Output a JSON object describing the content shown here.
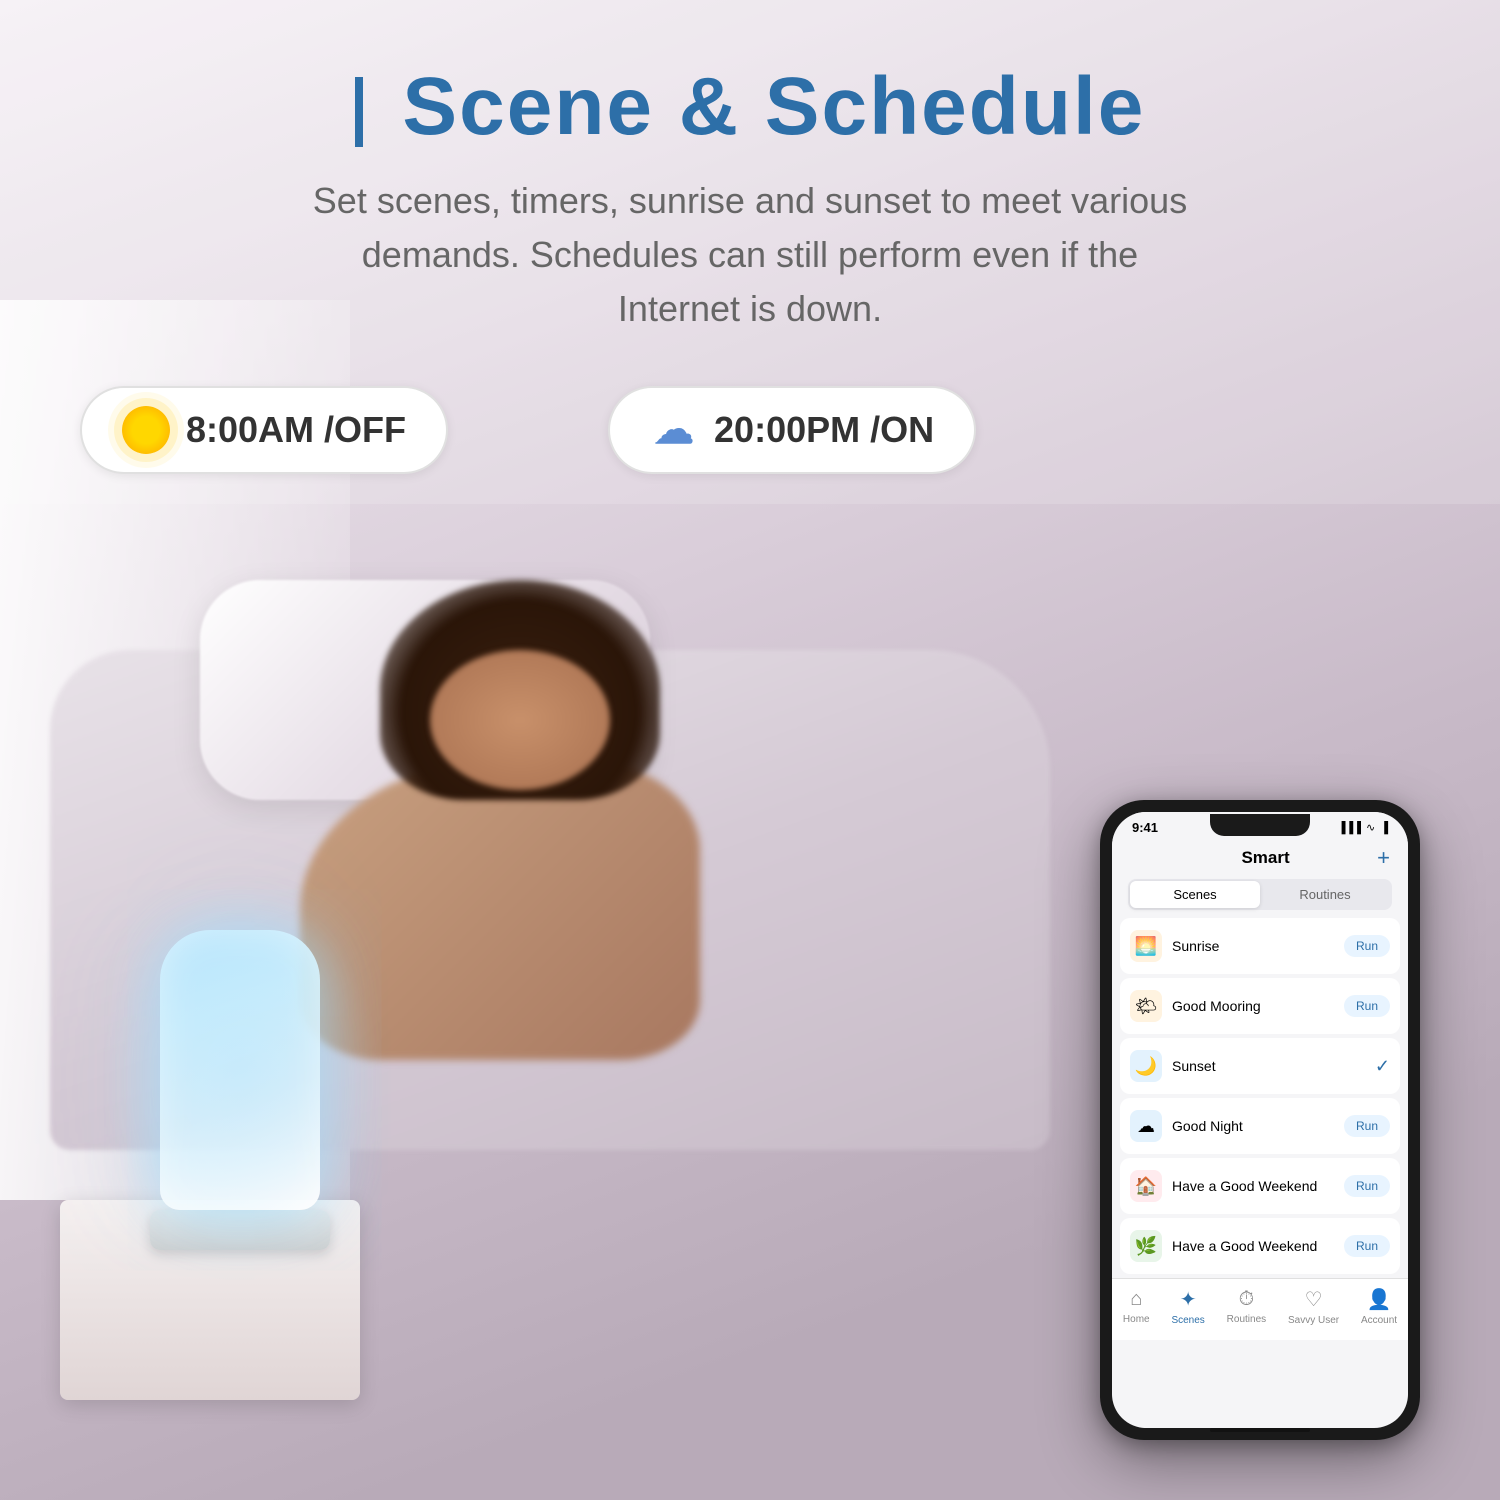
{
  "page": {
    "background_color": "#f0eef0"
  },
  "header": {
    "title": "Scene & Schedule",
    "title_bar": "I",
    "subtitle": "Set scenes, timers, sunrise and sunset to meet various demands. Schedules can still perform even if the Internet is down."
  },
  "schedules": [
    {
      "icon": "sun",
      "time": "8:00AM",
      "status": "OFF",
      "label": "8:00AM /OFF"
    },
    {
      "icon": "moon-cloud",
      "time": "20:00PM",
      "status": "ON",
      "label": "20:00PM /ON"
    }
  ],
  "phone": {
    "status_bar": {
      "time": "9:41",
      "signal": "▐▐▐",
      "wifi": "WiFi",
      "battery": "🔋"
    },
    "app": {
      "title": "Smart",
      "add_button": "+",
      "tabs": [
        {
          "label": "Scenes",
          "active": true
        },
        {
          "label": "Routines",
          "active": false
        }
      ],
      "scenes": [
        {
          "name": "Sunrise",
          "icon": "🌅",
          "icon_bg": "#fff3e0",
          "action": "Run",
          "checked": false
        },
        {
          "name": "Good Mooring",
          "icon": "🌤",
          "icon_bg": "#fff3e0",
          "action": "Run",
          "checked": false
        },
        {
          "name": "Sunset",
          "icon": "🌙",
          "icon_bg": "#e3f2fd",
          "action": null,
          "checked": true
        },
        {
          "name": "Good Night",
          "icon": "☁",
          "icon_bg": "#e3f2fd",
          "action": "Run",
          "checked": false
        },
        {
          "name": "Have a Good Weekend",
          "icon": "🏠",
          "icon_bg": "#ffebee",
          "action": "Run",
          "checked": false
        },
        {
          "name": "Have a Good Weekend",
          "icon": "🌿",
          "icon_bg": "#e8f5e9",
          "action": "Run",
          "checked": false
        }
      ],
      "bottom_nav": [
        {
          "label": "Home",
          "icon": "⌂",
          "active": false
        },
        {
          "label": "Scenes",
          "icon": "✦",
          "active": true
        },
        {
          "label": "Routines",
          "icon": "⏱",
          "active": false
        },
        {
          "label": "Savvy User",
          "icon": "♡",
          "active": false
        },
        {
          "label": "Account",
          "icon": "👤",
          "active": false
        }
      ]
    }
  }
}
